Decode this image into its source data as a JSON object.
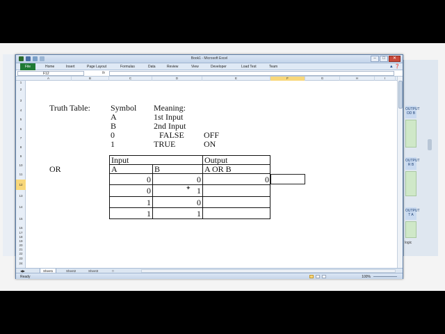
{
  "window": {
    "title": "Book1 - Microsoft Excel",
    "file_tab": "File",
    "ribbon_tabs": [
      "Home",
      "Insert",
      "Page Layout",
      "Formulas",
      "Data",
      "Review",
      "View",
      "Developer",
      "Load Test",
      "Team"
    ],
    "minimize": "–",
    "maximize": "□",
    "close": "✕"
  },
  "formula_bar": {
    "name_box": "F12",
    "fx_label": "fx",
    "content": ""
  },
  "columns": [
    "A",
    "B",
    "C",
    "D",
    "E",
    "F",
    "G",
    "H",
    "I"
  ],
  "selected_column": "F",
  "rows": [
    "1",
    "2",
    "3",
    "4",
    "5",
    "6",
    "7",
    "8",
    "9",
    "10",
    "11",
    "12",
    "13",
    "14",
    "15",
    "16",
    "17",
    "18",
    "19",
    "20",
    "21",
    "22",
    "23",
    "24"
  ],
  "selected_row": "12",
  "cells": {
    "b4": "Truth Table:",
    "c4": "Symbol",
    "d4": "Meaning:",
    "c5": "A",
    "d5": "1st Input",
    "c6": "B",
    "d6": "2nd Input",
    "c7": "0",
    "d7": "FALSE",
    "e7": "OFF",
    "c8": "1",
    "d8": "TRUE",
    "e8": "ON",
    "c10": "Input",
    "e10": "Output",
    "b11": "OR",
    "c11": "A",
    "d11": "B",
    "e11": "A OR B",
    "c12": "0",
    "d12": "0",
    "e12": "0",
    "c13": "0",
    "d13": "1",
    "c14": "1",
    "d14": "0",
    "c15": "1",
    "d15": "1"
  },
  "sheets": [
    "Sheet1",
    "Sheet2",
    "Sheet3"
  ],
  "active_sheet": "Sheet1",
  "status": {
    "mode": "Ready",
    "zoom": "100%"
  },
  "background_window": {
    "tags": [
      "OUTPUT\nOD B",
      "OUTPUT\nR B",
      "OUTPUT\nT A"
    ],
    "footer": "logic"
  }
}
